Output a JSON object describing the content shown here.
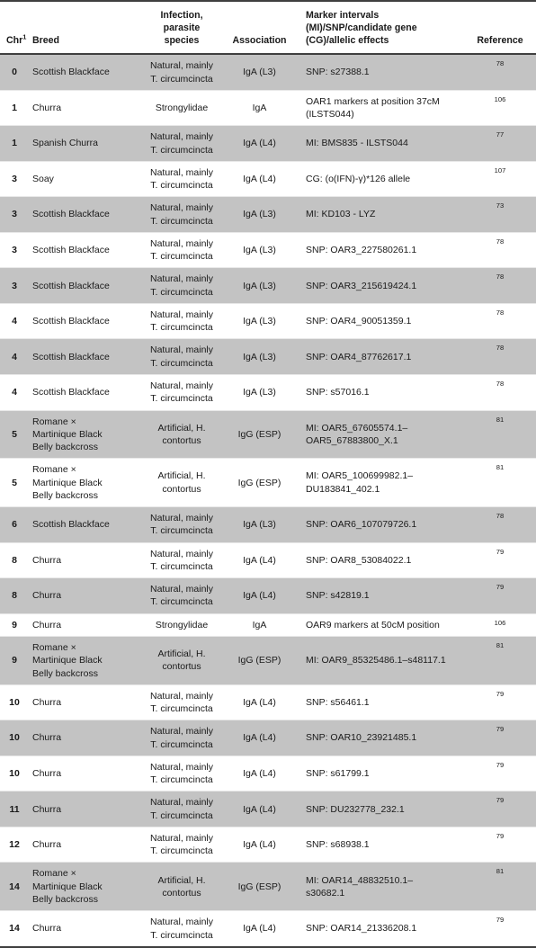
{
  "table": {
    "columns": [
      {
        "key": "chr",
        "label": "Chr",
        "superscript": "1"
      },
      {
        "key": "breed",
        "label": "Breed"
      },
      {
        "key": "inf",
        "label": "Infection,\nparasite species"
      },
      {
        "key": "assoc",
        "label": "Association"
      },
      {
        "key": "marker",
        "label": "Marker intervals\n(MI)/SNP/candidate gene\n(CG)/allelic effects"
      },
      {
        "key": "ref",
        "label": "Reference"
      }
    ],
    "style": {
      "shaded_row_color": "#c3c3c3",
      "plain_row_color": "#ffffff",
      "rule_color": "#3f3f3f",
      "row_divider_color": "#e8e8e8",
      "text_color": "#1a1a1a"
    },
    "rows": [
      {
        "chr": "0",
        "breed": "Scottish Blackface",
        "inf": "Natural, mainly\nT. circumcincta",
        "assoc": "IgA (L3)",
        "marker": "SNP: s27388.1",
        "ref": "78"
      },
      {
        "chr": "1",
        "breed": "Churra",
        "inf": "Strongylidae",
        "assoc": "IgA",
        "marker": "OAR1 markers at position 37cM\n(ILSTS044)",
        "ref": "106"
      },
      {
        "chr": "1",
        "breed": "Spanish Churra",
        "inf": "Natural, mainly\nT. circumcincta",
        "assoc": "IgA (L4)",
        "marker": "MI: BMS835 - ILSTS044",
        "ref": "77"
      },
      {
        "chr": "3",
        "breed": "Soay",
        "inf": "Natural, mainly\nT. circumcincta",
        "assoc": "IgA (L4)",
        "marker": "CG: (o(IFN)-γ)*126 allele",
        "ref": "107"
      },
      {
        "chr": "3",
        "breed": "Scottish Blackface",
        "inf": "Natural, mainly\nT. circumcincta",
        "assoc": "IgA (L3)",
        "marker": "MI: KD103 - LYZ",
        "ref": "73"
      },
      {
        "chr": "3",
        "breed": "Scottish Blackface",
        "inf": "Natural, mainly\nT. circumcincta",
        "assoc": "IgA (L3)",
        "marker": "SNP: OAR3_227580261.1",
        "ref": "78"
      },
      {
        "chr": "3",
        "breed": "Scottish Blackface",
        "inf": "Natural, mainly\nT. circumcincta",
        "assoc": "IgA (L3)",
        "marker": "SNP: OAR3_215619424.1",
        "ref": "78"
      },
      {
        "chr": "4",
        "breed": "Scottish Blackface",
        "inf": "Natural, mainly\nT. circumcincta",
        "assoc": "IgA (L3)",
        "marker": "SNP: OAR4_90051359.1",
        "ref": "78"
      },
      {
        "chr": "4",
        "breed": "Scottish Blackface",
        "inf": "Natural, mainly\nT. circumcincta",
        "assoc": "IgA (L3)",
        "marker": "SNP: OAR4_87762617.1",
        "ref": "78"
      },
      {
        "chr": "4",
        "breed": "Scottish Blackface",
        "inf": "Natural, mainly\nT. circumcincta",
        "assoc": "IgA (L3)",
        "marker": "SNP: s57016.1",
        "ref": "78"
      },
      {
        "chr": "5",
        "breed": "Romane ×\nMartinique Black\nBelly backcross",
        "inf": "Artificial, H.\ncontortus",
        "assoc": "IgG (ESP)",
        "marker": "MI: OAR5_67605574.1–\nOAR5_67883800_X.1",
        "ref": "81"
      },
      {
        "chr": "5",
        "breed": "Romane ×\nMartinique Black\nBelly backcross",
        "inf": "Artificial, H.\ncontortus",
        "assoc": "IgG (ESP)",
        "marker": "MI: OAR5_100699982.1–\nDU183841_402.1",
        "ref": "81"
      },
      {
        "chr": "6",
        "breed": "Scottish Blackface",
        "inf": "Natural, mainly\nT. circumcincta",
        "assoc": "IgA (L3)",
        "marker": "SNP: OAR6_107079726.1",
        "ref": "78"
      },
      {
        "chr": "8",
        "breed": "Churra",
        "inf": "Natural, mainly\nT. circumcincta",
        "assoc": "IgA (L4)",
        "marker": "SNP: OAR8_53084022.1",
        "ref": "79"
      },
      {
        "chr": "8",
        "breed": "Churra",
        "inf": "Natural, mainly\nT. circumcincta",
        "assoc": "IgA (L4)",
        "marker": "SNP: s42819.1",
        "ref": "79"
      },
      {
        "chr": "9",
        "breed": "Churra",
        "inf": "Strongylidae",
        "assoc": "IgA",
        "marker": "OAR9 markers at 50cM position",
        "ref": "106"
      },
      {
        "chr": "9",
        "breed": "Romane ×\nMartinique Black\nBelly backcross",
        "inf": "Artificial, H.\ncontortus",
        "assoc": "IgG (ESP)",
        "marker": "MI: OAR9_85325486.1–s48117.1",
        "ref": "81"
      },
      {
        "chr": "10",
        "breed": "Churra",
        "inf": "Natural, mainly\nT. circumcincta",
        "assoc": "IgA (L4)",
        "marker": "SNP: s56461.1",
        "ref": "79"
      },
      {
        "chr": "10",
        "breed": "Churra",
        "inf": "Natural, mainly\nT. circumcincta",
        "assoc": "IgA (L4)",
        "marker": "SNP: OAR10_23921485.1",
        "ref": "79"
      },
      {
        "chr": "10",
        "breed": "Churra",
        "inf": "Natural, mainly\nT. circumcincta",
        "assoc": "IgA (L4)",
        "marker": "SNP: s61799.1",
        "ref": "79"
      },
      {
        "chr": "11",
        "breed": "Churra",
        "inf": "Natural, mainly\nT. circumcincta",
        "assoc": "IgA (L4)",
        "marker": "SNP: DU232778_232.1",
        "ref": "79"
      },
      {
        "chr": "12",
        "breed": "Churra",
        "inf": "Natural, mainly\nT. circumcincta",
        "assoc": "IgA (L4)",
        "marker": "SNP: s68938.1",
        "ref": "79"
      },
      {
        "chr": "14",
        "breed": "Romane ×\nMartinique Black\nBelly backcross",
        "inf": "Artificial, H.\ncontortus",
        "assoc": "IgG (ESP)",
        "marker": "MI: OAR14_48832510.1–\ns30682.1",
        "ref": "81"
      },
      {
        "chr": "14",
        "breed": "Churra",
        "inf": "Natural, mainly\nT. circumcincta",
        "assoc": "IgA (L4)",
        "marker": "SNP: OAR14_21336208.1",
        "ref": "79"
      }
    ]
  }
}
